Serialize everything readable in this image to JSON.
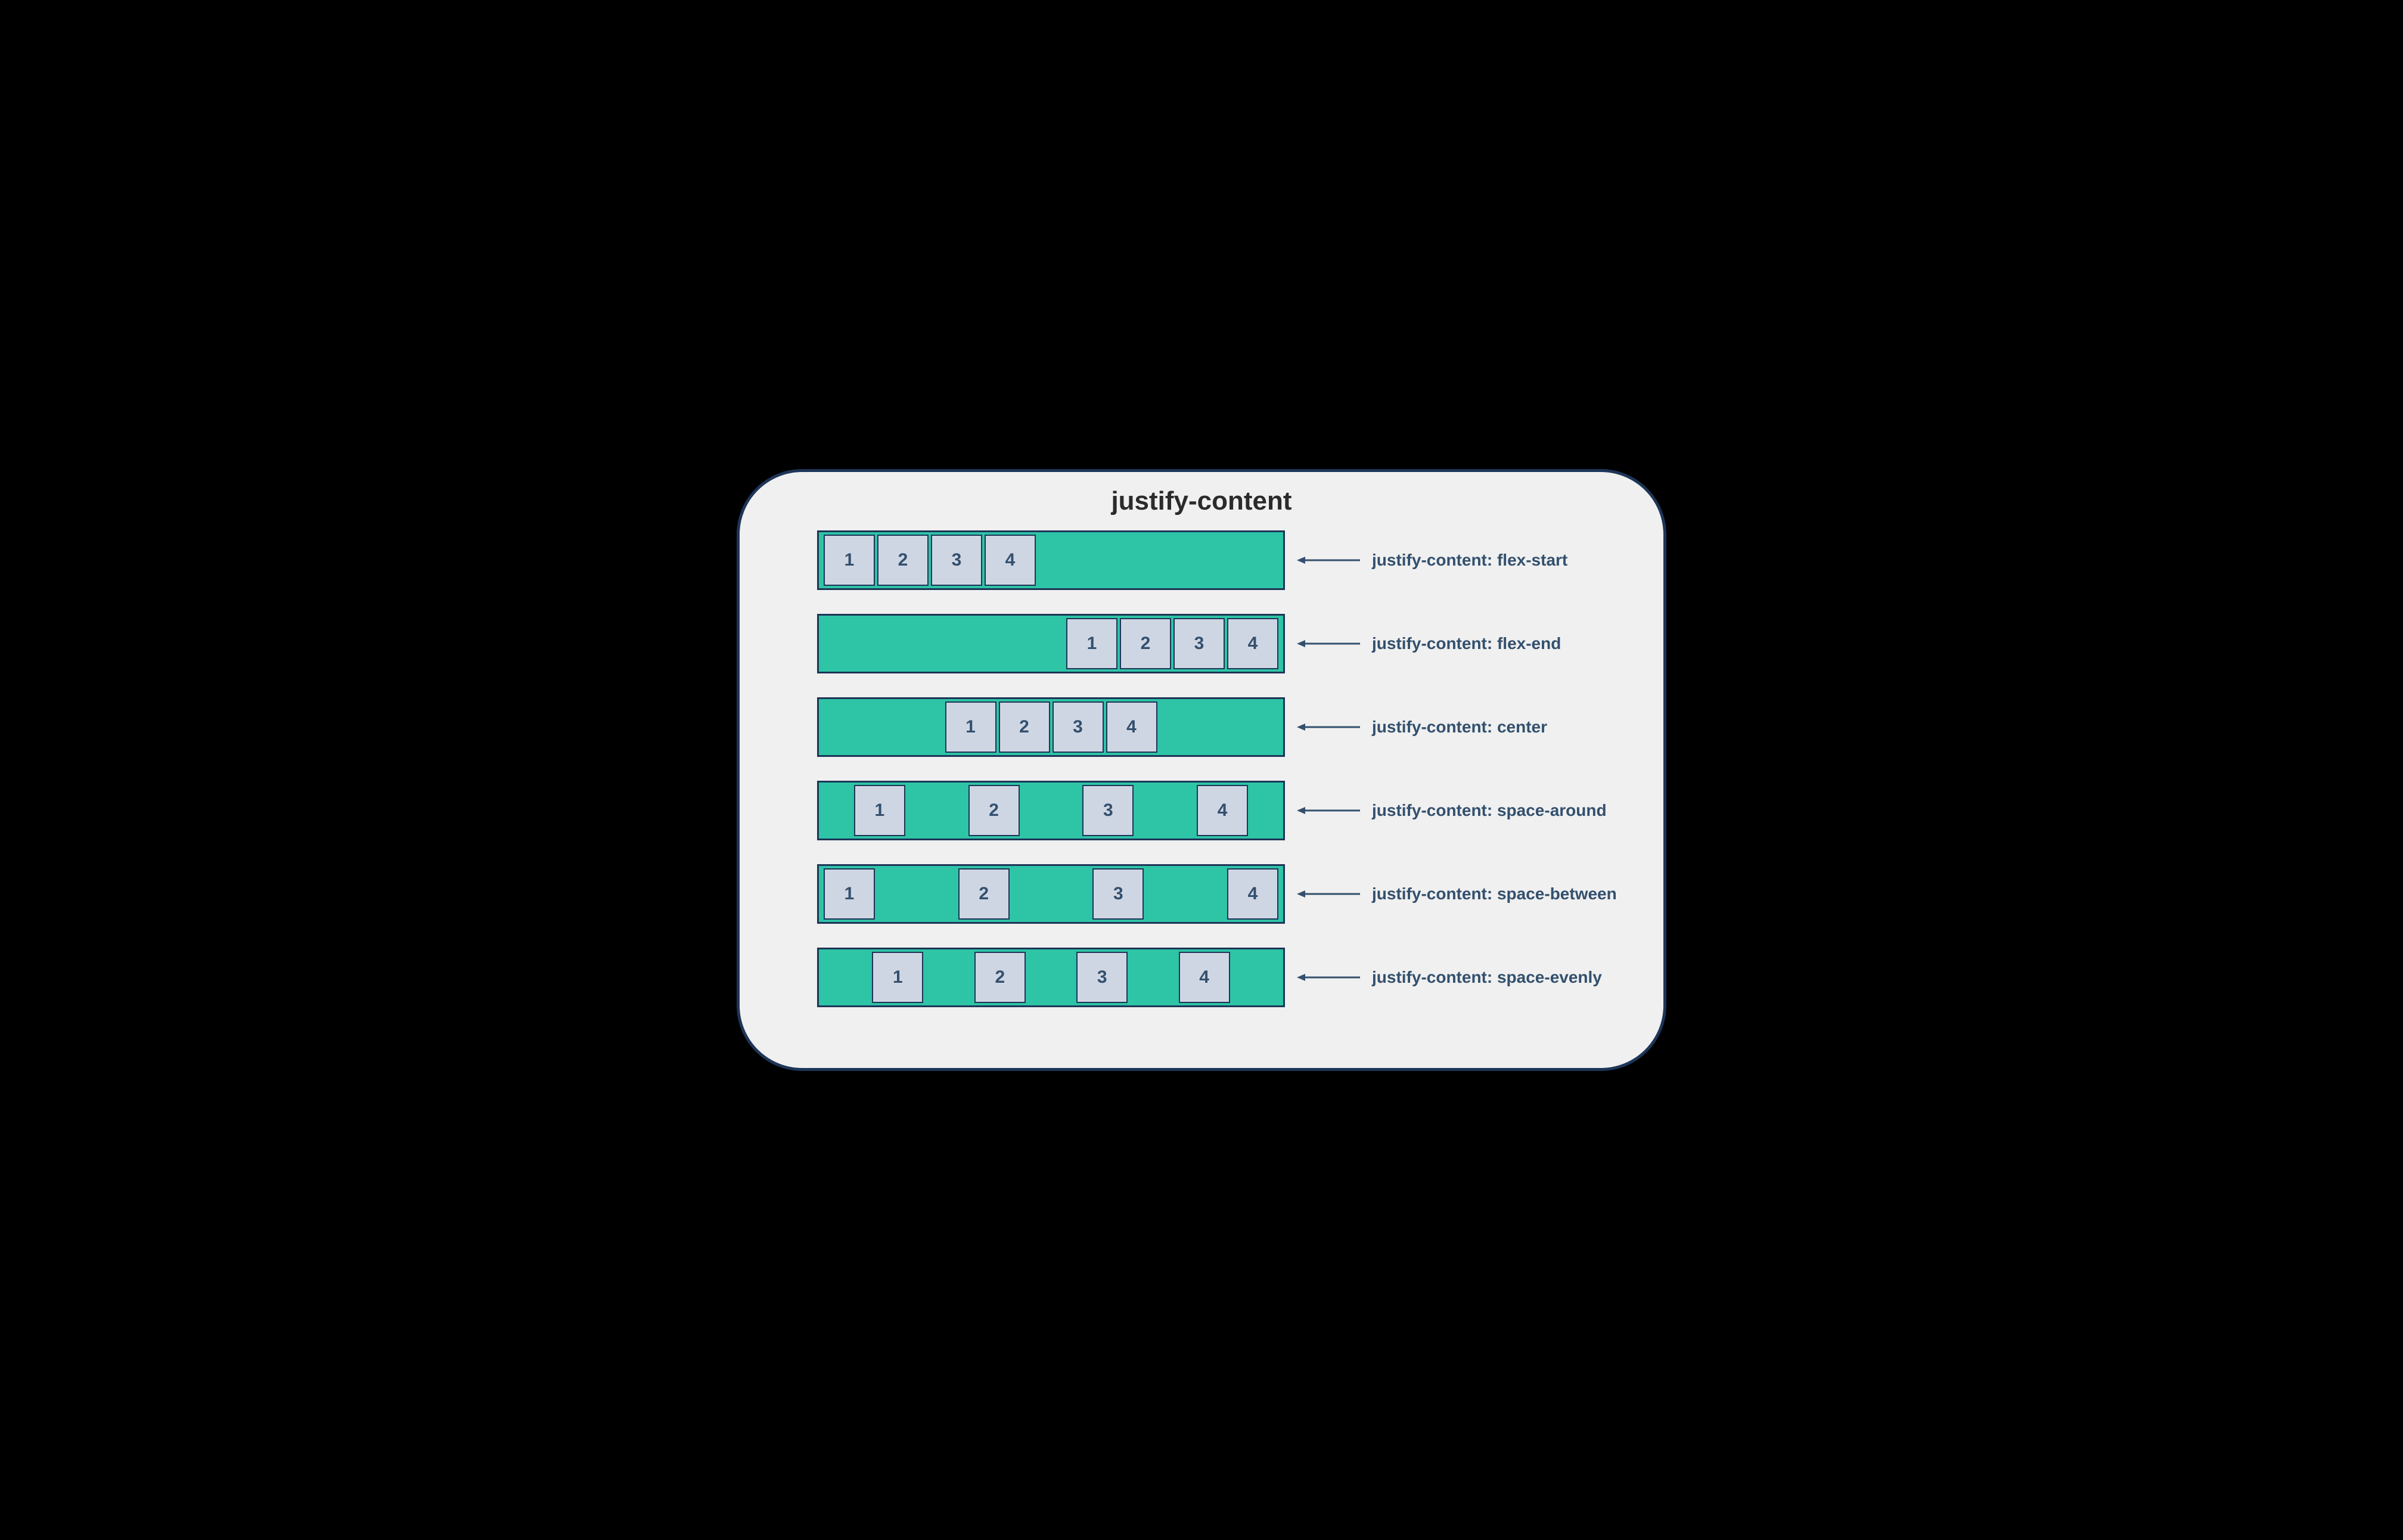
{
  "title": "justify-content",
  "box_labels": [
    "1",
    "2",
    "3",
    "4"
  ],
  "examples": [
    {
      "value": "flex-start",
      "label": "justify-content: flex-start"
    },
    {
      "value": "flex-end",
      "label": "justify-content: flex-end"
    },
    {
      "value": "center",
      "label": "justify-content: center"
    },
    {
      "value": "space-around",
      "label": "justify-content: space-around"
    },
    {
      "value": "space-between",
      "label": "justify-content: space-between"
    },
    {
      "value": "space-evenly",
      "label": "justify-content: space-evenly"
    }
  ],
  "colors": {
    "container_bg": "#2ec4a6",
    "box_bg": "#cfd6e3",
    "border": "#1d3557",
    "text": "#33506e",
    "card_bg": "#f0f0f0"
  }
}
